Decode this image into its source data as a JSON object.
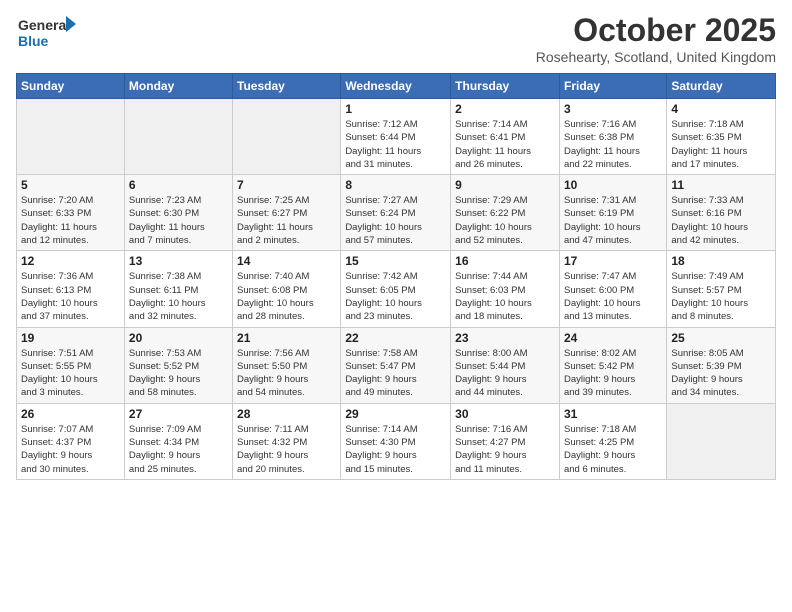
{
  "header": {
    "logo_line1": "General",
    "logo_line2": "Blue",
    "month": "October 2025",
    "location": "Rosehearty, Scotland, United Kingdom"
  },
  "days_of_week": [
    "Sunday",
    "Monday",
    "Tuesday",
    "Wednesday",
    "Thursday",
    "Friday",
    "Saturday"
  ],
  "weeks": [
    [
      {
        "day": "",
        "info": ""
      },
      {
        "day": "",
        "info": ""
      },
      {
        "day": "",
        "info": ""
      },
      {
        "day": "1",
        "info": "Sunrise: 7:12 AM\nSunset: 6:44 PM\nDaylight: 11 hours\nand 31 minutes."
      },
      {
        "day": "2",
        "info": "Sunrise: 7:14 AM\nSunset: 6:41 PM\nDaylight: 11 hours\nand 26 minutes."
      },
      {
        "day": "3",
        "info": "Sunrise: 7:16 AM\nSunset: 6:38 PM\nDaylight: 11 hours\nand 22 minutes."
      },
      {
        "day": "4",
        "info": "Sunrise: 7:18 AM\nSunset: 6:35 PM\nDaylight: 11 hours\nand 17 minutes."
      }
    ],
    [
      {
        "day": "5",
        "info": "Sunrise: 7:20 AM\nSunset: 6:33 PM\nDaylight: 11 hours\nand 12 minutes."
      },
      {
        "day": "6",
        "info": "Sunrise: 7:23 AM\nSunset: 6:30 PM\nDaylight: 11 hours\nand 7 minutes."
      },
      {
        "day": "7",
        "info": "Sunrise: 7:25 AM\nSunset: 6:27 PM\nDaylight: 11 hours\nand 2 minutes."
      },
      {
        "day": "8",
        "info": "Sunrise: 7:27 AM\nSunset: 6:24 PM\nDaylight: 10 hours\nand 57 minutes."
      },
      {
        "day": "9",
        "info": "Sunrise: 7:29 AM\nSunset: 6:22 PM\nDaylight: 10 hours\nand 52 minutes."
      },
      {
        "day": "10",
        "info": "Sunrise: 7:31 AM\nSunset: 6:19 PM\nDaylight: 10 hours\nand 47 minutes."
      },
      {
        "day": "11",
        "info": "Sunrise: 7:33 AM\nSunset: 6:16 PM\nDaylight: 10 hours\nand 42 minutes."
      }
    ],
    [
      {
        "day": "12",
        "info": "Sunrise: 7:36 AM\nSunset: 6:13 PM\nDaylight: 10 hours\nand 37 minutes."
      },
      {
        "day": "13",
        "info": "Sunrise: 7:38 AM\nSunset: 6:11 PM\nDaylight: 10 hours\nand 32 minutes."
      },
      {
        "day": "14",
        "info": "Sunrise: 7:40 AM\nSunset: 6:08 PM\nDaylight: 10 hours\nand 28 minutes."
      },
      {
        "day": "15",
        "info": "Sunrise: 7:42 AM\nSunset: 6:05 PM\nDaylight: 10 hours\nand 23 minutes."
      },
      {
        "day": "16",
        "info": "Sunrise: 7:44 AM\nSunset: 6:03 PM\nDaylight: 10 hours\nand 18 minutes."
      },
      {
        "day": "17",
        "info": "Sunrise: 7:47 AM\nSunset: 6:00 PM\nDaylight: 10 hours\nand 13 minutes."
      },
      {
        "day": "18",
        "info": "Sunrise: 7:49 AM\nSunset: 5:57 PM\nDaylight: 10 hours\nand 8 minutes."
      }
    ],
    [
      {
        "day": "19",
        "info": "Sunrise: 7:51 AM\nSunset: 5:55 PM\nDaylight: 10 hours\nand 3 minutes."
      },
      {
        "day": "20",
        "info": "Sunrise: 7:53 AM\nSunset: 5:52 PM\nDaylight: 9 hours\nand 58 minutes."
      },
      {
        "day": "21",
        "info": "Sunrise: 7:56 AM\nSunset: 5:50 PM\nDaylight: 9 hours\nand 54 minutes."
      },
      {
        "day": "22",
        "info": "Sunrise: 7:58 AM\nSunset: 5:47 PM\nDaylight: 9 hours\nand 49 minutes."
      },
      {
        "day": "23",
        "info": "Sunrise: 8:00 AM\nSunset: 5:44 PM\nDaylight: 9 hours\nand 44 minutes."
      },
      {
        "day": "24",
        "info": "Sunrise: 8:02 AM\nSunset: 5:42 PM\nDaylight: 9 hours\nand 39 minutes."
      },
      {
        "day": "25",
        "info": "Sunrise: 8:05 AM\nSunset: 5:39 PM\nDaylight: 9 hours\nand 34 minutes."
      }
    ],
    [
      {
        "day": "26",
        "info": "Sunrise: 7:07 AM\nSunset: 4:37 PM\nDaylight: 9 hours\nand 30 minutes."
      },
      {
        "day": "27",
        "info": "Sunrise: 7:09 AM\nSunset: 4:34 PM\nDaylight: 9 hours\nand 25 minutes."
      },
      {
        "day": "28",
        "info": "Sunrise: 7:11 AM\nSunset: 4:32 PM\nDaylight: 9 hours\nand 20 minutes."
      },
      {
        "day": "29",
        "info": "Sunrise: 7:14 AM\nSunset: 4:30 PM\nDaylight: 9 hours\nand 15 minutes."
      },
      {
        "day": "30",
        "info": "Sunrise: 7:16 AM\nSunset: 4:27 PM\nDaylight: 9 hours\nand 11 minutes."
      },
      {
        "day": "31",
        "info": "Sunrise: 7:18 AM\nSunset: 4:25 PM\nDaylight: 9 hours\nand 6 minutes."
      },
      {
        "day": "",
        "info": ""
      }
    ]
  ]
}
